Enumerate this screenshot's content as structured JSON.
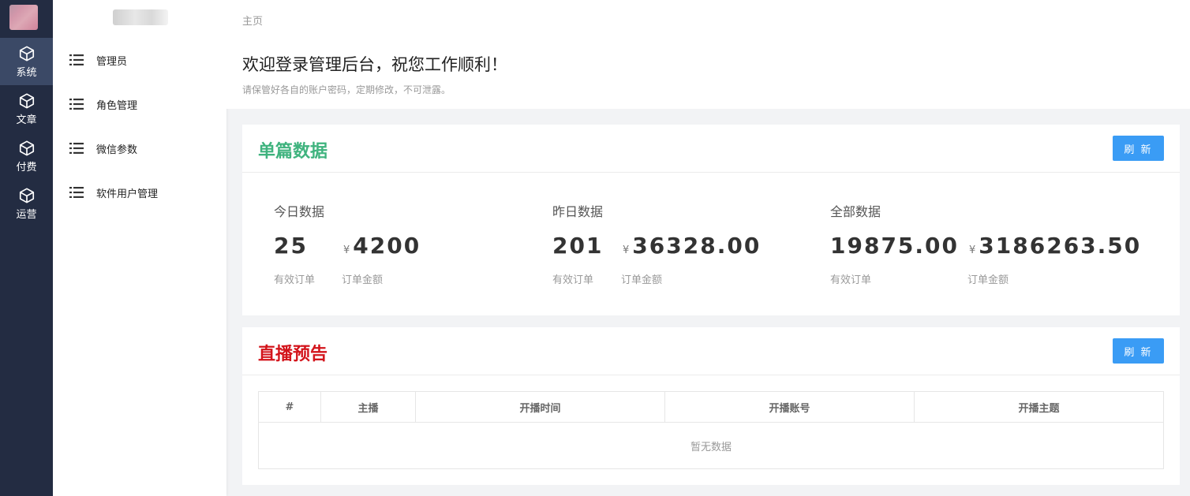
{
  "rail": {
    "items": [
      {
        "label": "系统",
        "icon": "cube-icon"
      },
      {
        "label": "文章",
        "icon": "cube-icon"
      },
      {
        "label": "付费",
        "icon": "cube-icon"
      },
      {
        "label": "运营",
        "icon": "cube-icon"
      }
    ]
  },
  "submenu": {
    "items": [
      {
        "label": "管理员",
        "icon": "list-icon"
      },
      {
        "label": "角色管理",
        "icon": "list-icon"
      },
      {
        "label": "微信参数",
        "icon": "list-icon"
      },
      {
        "label": "软件用户管理",
        "icon": "list-icon"
      }
    ]
  },
  "header": {
    "breadcrumb": "主页",
    "welcome": "欢迎登录管理后台，祝您工作顺利！",
    "tip": "请保管好各自的账户密码，定期修改，不可泄露。"
  },
  "single_data": {
    "title": "单篇数据",
    "refresh_label": "刷 新",
    "currency_symbol": "¥",
    "stats": [
      {
        "title": "今日数据",
        "orders": "25",
        "amount": "4200",
        "orders_label": "有效订单",
        "amount_label": "订单金额"
      },
      {
        "title": "昨日数据",
        "orders": "201",
        "amount": "36328.00",
        "orders_label": "有效订单",
        "amount_label": "订单金额"
      },
      {
        "title": "全部数据",
        "orders": "19875.00",
        "amount": "3186263.50",
        "orders_label": "有效订单",
        "amount_label": "订单金额"
      }
    ]
  },
  "live_preview": {
    "title": "直播预告",
    "refresh_label": "刷 新",
    "columns": [
      "#",
      "主播",
      "开播时间",
      "开播账号",
      "开播主题"
    ],
    "empty_text": "暂无数据"
  },
  "colors": {
    "rail_bg": "#232c42",
    "rail_active": "#3b4966",
    "accent_green": "#3fb37e",
    "accent_red": "#d3141b",
    "button_blue": "#3a9cf5"
  }
}
